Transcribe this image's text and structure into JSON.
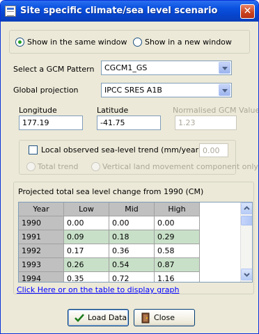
{
  "window": {
    "title": "Site specific climate/sea level scenario",
    "close_glyph": "✕"
  },
  "display": {
    "options": [
      {
        "label": "Show in the same window",
        "selected": true
      },
      {
        "label": "Show in a new window",
        "selected": false
      }
    ]
  },
  "gcm": {
    "label": "Select a  GCM Pattern",
    "value": "CGCM1_GS"
  },
  "projection": {
    "label": "Global projection",
    "value": "IPCC SRES A1B"
  },
  "location": {
    "longitude_label": "Longitude",
    "longitude_value": "177.19",
    "latitude_label": "Latitude",
    "latitude_value": "-41.75",
    "gcm_value_label": "Normalised GCM Value",
    "gcm_value": "1.23"
  },
  "sea_level": {
    "checkbox_label": "Local observed sea-level trend (mm/year)",
    "checked": false,
    "trend_value": "0.00",
    "total_trend_label": "Total trend",
    "vertical_label": "Vertical land movement component only"
  },
  "table": {
    "caption": "Projected total sea level change from 1990 (CM)",
    "columns": [
      "Year",
      "Low",
      "Mid",
      "High"
    ],
    "rows": [
      [
        "1990",
        "0.00",
        "0.00",
        "0.00"
      ],
      [
        "1991",
        "0.09",
        "0.18",
        "0.29"
      ],
      [
        "1992",
        "0.17",
        "0.36",
        "0.58"
      ],
      [
        "1993",
        "0.26",
        "0.54",
        "0.87"
      ],
      [
        "1994",
        "0.35",
        "0.72",
        "1.16"
      ]
    ],
    "graph_link": "Click Here or on the table to display graph"
  },
  "buttons": {
    "load_label": "Load Data",
    "close_label": "Close"
  },
  "colors": {
    "title_bar": "#0a52e0",
    "dialog_bg": "#ece9d8",
    "alt_row": "#c8e0c8",
    "link": "#0000ff"
  }
}
